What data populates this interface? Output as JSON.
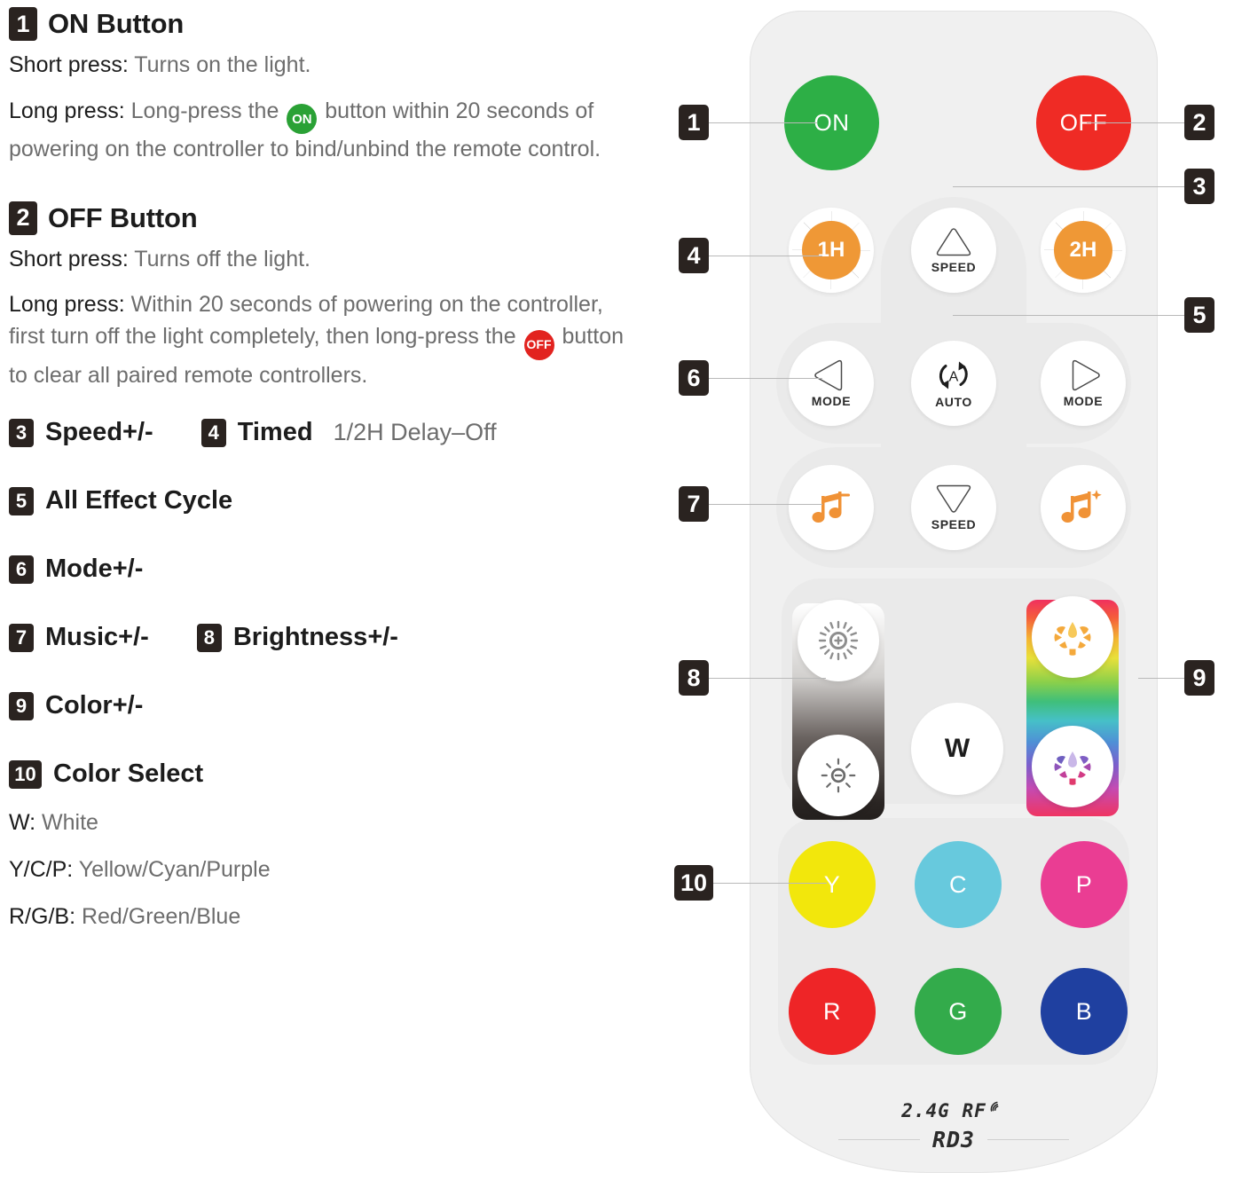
{
  "sections": [
    {
      "number": "1",
      "title": "ON Button",
      "short_lead": "Short press:",
      "short_text": " Turns on the light.",
      "long_lead": "Long press:",
      "long_text_before": " Long-press the ",
      "badge": "ON",
      "long_text_after": " button within 20 seconds of powering on the controller to bind/unbind the remote control."
    },
    {
      "number": "2",
      "title": "OFF Button",
      "short_lead": "Short press:",
      "short_text": " Turns off the light.",
      "long_lead": "Long press:",
      "long_text_before": " Within 20 seconds of powering on the controller, first turn off the light completely, then long-press the ",
      "badge": "OFF",
      "long_text_after": " button to clear all paired remote controllers."
    }
  ],
  "list_rows": [
    [
      {
        "number": "3",
        "label": "Speed+/-",
        "sub": ""
      },
      {
        "number": "4",
        "label": "Timed",
        "sub": "1/2H Delay–Off"
      }
    ],
    [
      {
        "number": "5",
        "label": "All Effect Cycle",
        "sub": ""
      }
    ],
    [
      {
        "number": "6",
        "label": "Mode+/-",
        "sub": ""
      }
    ],
    [
      {
        "number": "7",
        "label": "Music+/-",
        "sub": ""
      },
      {
        "number": "8",
        "label": "Brightness+/-",
        "sub": ""
      }
    ],
    [
      {
        "number": "9",
        "label": "Color+/-",
        "sub": ""
      }
    ],
    [
      {
        "number": "10",
        "label": "Color Select",
        "sub": ""
      }
    ]
  ],
  "color_legend": [
    {
      "key": "W:",
      "value": " White"
    },
    {
      "key": "Y/C/P:",
      "value": " Yellow/Cyan/Purple"
    },
    {
      "key": "R/G/B:",
      "value": " Red/Green/Blue"
    }
  ],
  "remote": {
    "power": {
      "on_label": "ON",
      "off_label": "OFF",
      "on_color": "#2daf46",
      "off_color": "#ef2b25"
    },
    "timers": [
      {
        "label": "1H"
      },
      {
        "label": "2H"
      }
    ],
    "speed_up": {
      "label": "SPEED",
      "icon": "triangle-up-icon"
    },
    "speed_down": {
      "label": "SPEED",
      "icon": "triangle-down-icon"
    },
    "mode_prev": {
      "label": "MODE",
      "icon": "triangle-left-icon"
    },
    "mode_next": {
      "label": "MODE",
      "icon": "triangle-right-icon"
    },
    "auto": {
      "label": "AUTO",
      "icon": "auto-cycle-icon",
      "glyph": "A"
    },
    "music_minus": {
      "icon": "music-note-minus-icon"
    },
    "music_plus": {
      "icon": "music-note-plus-icon"
    },
    "brightness_up": {
      "icon": "brightness-up-icon"
    },
    "brightness_down": {
      "icon": "brightness-down-icon"
    },
    "white": {
      "label": "W"
    },
    "color_up": {
      "icon": "color-wheel-warm-icon"
    },
    "color_down": {
      "icon": "color-wheel-cool-icon"
    },
    "colors": [
      {
        "label": "Y",
        "color": "#f2e70c"
      },
      {
        "label": "C",
        "color": "#67c9dd"
      },
      {
        "label": "P",
        "color": "#ea3d93"
      },
      {
        "label": "R",
        "color": "#ee2527"
      },
      {
        "label": "G",
        "color": "#33ab4b"
      },
      {
        "label": "B",
        "color": "#1f40a0"
      }
    ],
    "brand": {
      "rf": "2.4G RF",
      "rf_icon": "wifi-signal-icon",
      "model": "RD3"
    }
  },
  "callouts": {
    "left": [
      {
        "number": "1"
      },
      {
        "number": "4"
      },
      {
        "number": "6"
      },
      {
        "number": "7"
      },
      {
        "number": "8"
      },
      {
        "number": "10"
      }
    ],
    "right": [
      {
        "number": "2"
      },
      {
        "number": "3"
      },
      {
        "number": "5"
      },
      {
        "number": "9"
      }
    ]
  }
}
